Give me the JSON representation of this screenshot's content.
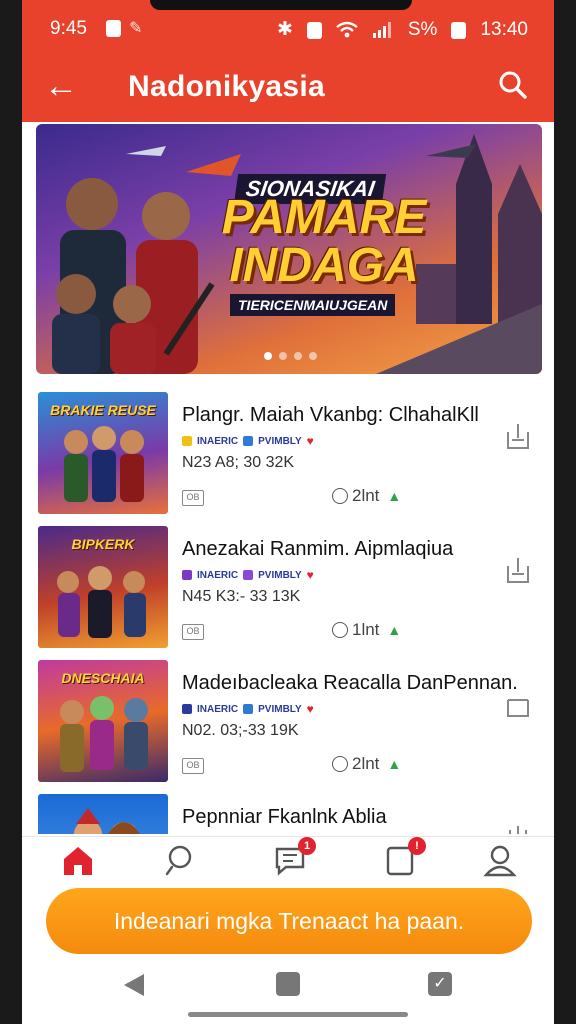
{
  "status_bar": {
    "time": "9:45",
    "battery": "S%",
    "clock_right": "13:40"
  },
  "app_bar": {
    "title": "Nadonikyasia"
  },
  "banner": {
    "kicker": "SIONASIKAI",
    "title_line1": "PAMARE",
    "title_line2": "INDAGA",
    "subtitle": "TIERICENMAIUJGEAN",
    "page_count": 4,
    "active_page": 1
  },
  "items": [
    {
      "title": "Plangr. Maiah  Vkanbg: ClhahalKll",
      "thumb_label": "BRAKIE REUSE",
      "tag1": "INAERIC",
      "tag2": "PVIMBLY",
      "stats": "N23  A8; 30 32K",
      "meta_icon": "OB",
      "count": "2lnt"
    },
    {
      "title": "Anezakai  Ranmim. Aipmlaqiua",
      "thumb_label": "BIPKERK",
      "tag1": "INAERIC",
      "tag2": "PVIMBLY",
      "stats": "N45  K3:- 33 13K",
      "meta_icon": "OB",
      "count": "1lnt"
    },
    {
      "title": "Madeıbacleaka Reacalla DanPennan.",
      "thumb_label": "DNESCHAIA",
      "tag1": "INAERIC",
      "tag2": "PVIMBLY",
      "stats": "N02. 03;-33 19K",
      "meta_icon": "OB",
      "count": "2lnt"
    },
    {
      "title": "Pepnniar Fkanlnk Ablia",
      "thumb_label": "",
      "tag1": "",
      "tag2": "",
      "stats": "",
      "meta_icon": "",
      "count": ""
    }
  ],
  "bottom_nav": {
    "messages_badge": "1",
    "notifications_badge": "!"
  },
  "cta": {
    "label": "Indeanari mgka Trenaact ha paan."
  },
  "colors": {
    "brand": "#e8412c",
    "cta": "#f7930f",
    "home_active": "#e0232e"
  }
}
